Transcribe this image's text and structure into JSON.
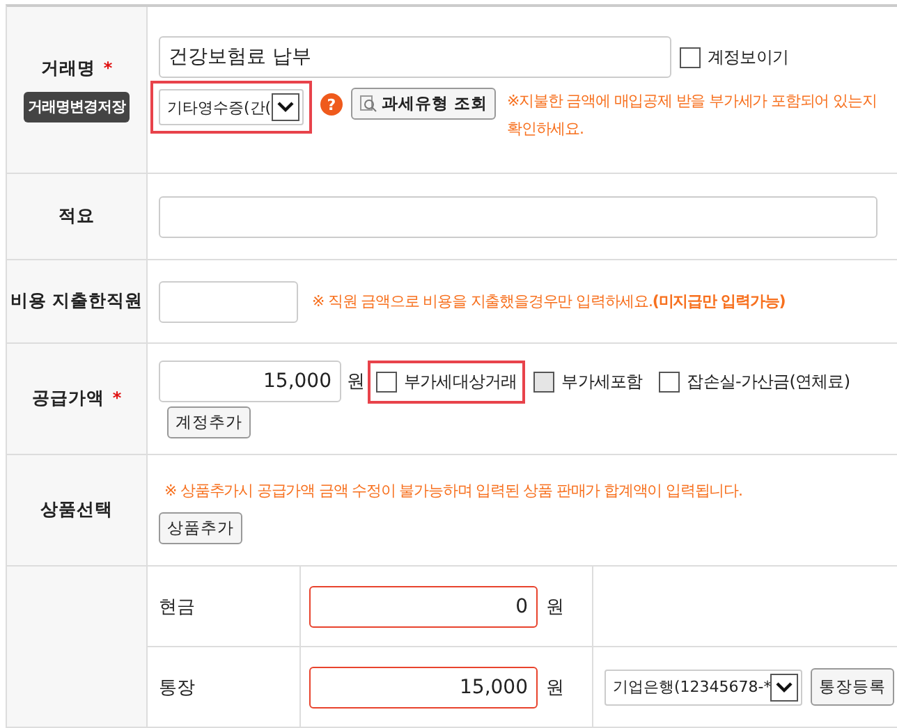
{
  "transaction_name": {
    "label": "거래명",
    "required": "*",
    "save_button": "거래명변경저장",
    "value": "건강보험료 납부",
    "show_account": {
      "label": "계정보이기",
      "checked": false
    },
    "receipt_select": {
      "value": "기타영수증(간(",
      "highlighted": true
    },
    "help_icon": "?",
    "tax_type_button": "과세유형 조회",
    "notice": "※지불한 금액에 매입공제 받을 부가세가 포함되어 있는지 확인하세요."
  },
  "memo": {
    "label": "적요"
  },
  "employee": {
    "label": "비용 지출한직원",
    "notice": "※ 직원 금액으로 비용을 지출했을경우만 입력하세요.**(미지급만 입력가능)**"
  },
  "supply": {
    "label": "공급가액",
    "required": "*",
    "value": "15,000",
    "unit": "원",
    "add_account_button": "계정추가",
    "checkboxes": [
      {
        "label": "부가세대상거래",
        "checked": false,
        "disabled": false,
        "highlighted": true
      },
      {
        "label": "부가세포함",
        "checked": false,
        "disabled": true,
        "highlighted": false
      },
      {
        "label": "잡손실-가산금(연체료)",
        "checked": false,
        "disabled": false,
        "highlighted": false
      }
    ]
  },
  "product": {
    "label": "상품선택",
    "notice": "※ 상품추가시 공급가액 금액 수정이 불가능하며 입력된 상품 판매가 합계액이 입력됩니다.",
    "add_button": "상품추가"
  },
  "payments": [
    {
      "label": "현금",
      "value": "0",
      "unit": "원"
    },
    {
      "label": "통장",
      "value": "15,000",
      "unit": "원",
      "bank_select": "기업은행(12345678-*",
      "register_button": "통장등록"
    }
  ]
}
